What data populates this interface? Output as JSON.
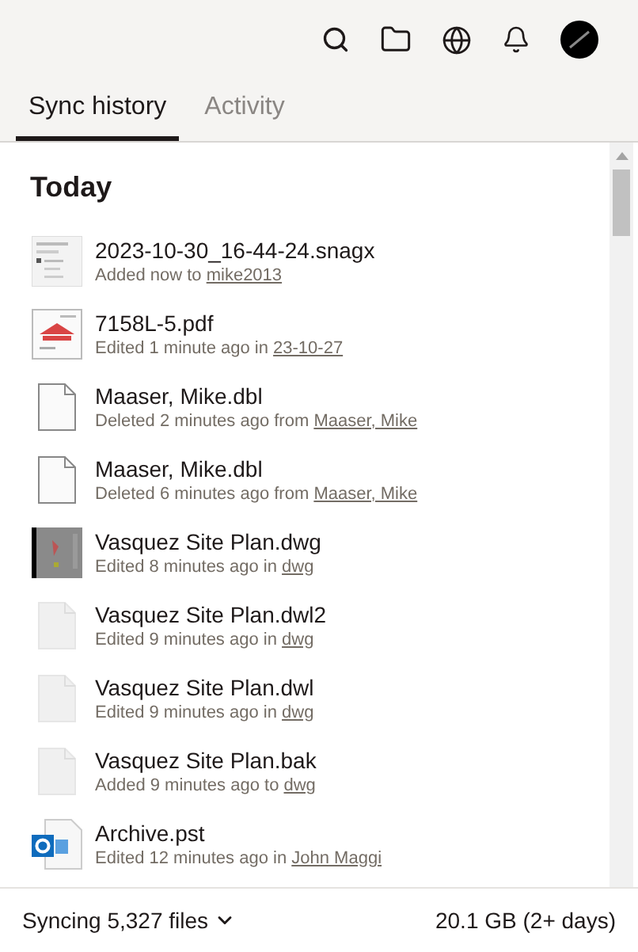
{
  "tabs": [
    {
      "label": "Sync history",
      "selected": true
    },
    {
      "label": "Activity",
      "selected": false
    }
  ],
  "section_title": "Today",
  "items": [
    {
      "kind": "screenshot",
      "name": "2023-10-30_16-44-24.snagx",
      "action": "Added now to ",
      "link": "mike2013"
    },
    {
      "kind": "pdf",
      "name": "7158L-5.pdf",
      "action": "Edited 1 minute ago in ",
      "link": "23-10-27"
    },
    {
      "kind": "file-outline",
      "name": "Maaser, Mike.dbl",
      "action": "Deleted 2 minutes ago from ",
      "link": "Maaser, Mike"
    },
    {
      "kind": "file-outline",
      "name": "Maaser, Mike.dbl",
      "action": "Deleted 6 minutes ago from ",
      "link": "Maaser, Mike"
    },
    {
      "kind": "drawing",
      "name": "Vasquez Site Plan.dwg",
      "action": "Edited 8 minutes ago in ",
      "link": "dwg"
    },
    {
      "kind": "file-light",
      "name": "Vasquez Site Plan.dwl2",
      "action": "Edited 9 minutes ago in ",
      "link": "dwg"
    },
    {
      "kind": "file-light",
      "name": "Vasquez Site Plan.dwl",
      "action": "Edited 9 minutes ago in ",
      "link": "dwg"
    },
    {
      "kind": "file-light",
      "name": "Vasquez Site Plan.bak",
      "action": "Added 9 minutes ago to ",
      "link": "dwg"
    },
    {
      "kind": "outlook",
      "name": "Archive.pst",
      "action": "Edited 12 minutes ago in ",
      "link": "John Maggi"
    }
  ],
  "footer": {
    "status": "Syncing 5,327 files",
    "size": "20.1 GB (2+ days)"
  }
}
